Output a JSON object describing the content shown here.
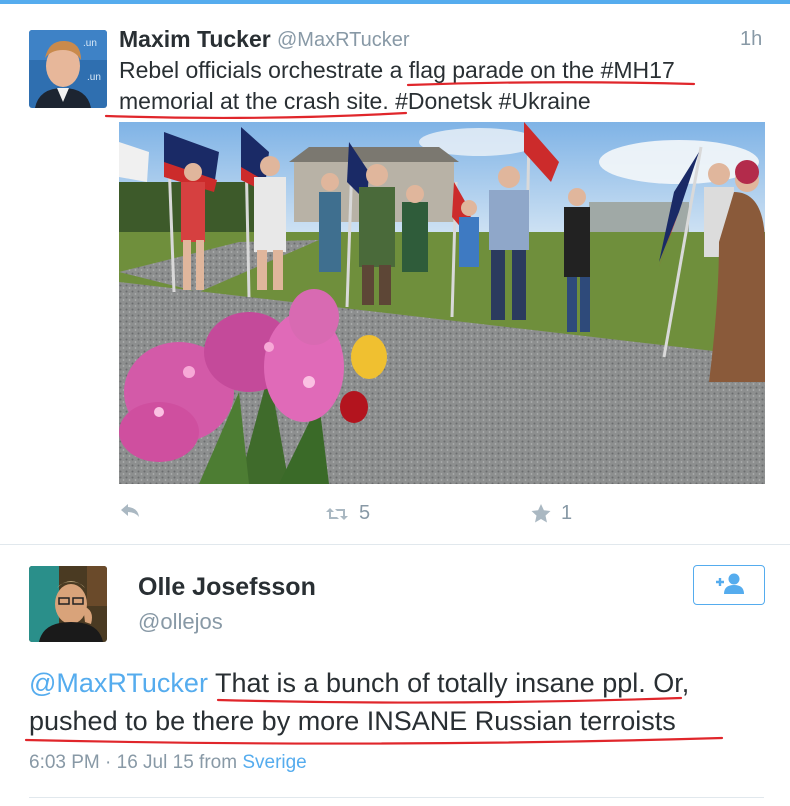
{
  "tweet": {
    "author_name": "Maxim Tucker",
    "author_handle": "@MaxRTucker",
    "time": "1h",
    "text_line1_a": "Rebel officials orchestrate a ",
    "text_line1_b": "flag parade on the #MH17",
    "text_line2_a": "memorial at the crash site.",
    "text_line2_b": " #Donetsk #Ukraine",
    "retweet_count": "5",
    "favorite_count": "1"
  },
  "reply": {
    "author_name": "Olle Josefsson",
    "author_handle": "@ollejos",
    "mention": "@MaxRTucker",
    "text_line1": " That is a bunch of totally insane ppl. Or,",
    "text_line2": "pushed to be there by more INSANE Russian terroists",
    "timestamp": "6:03 PM · 16 Jul 15 from ",
    "via": "Sverige"
  },
  "colors": {
    "accent": "#55acee",
    "text": "#292f33",
    "muted": "#8899a6",
    "annotation_red": "#e0262b"
  },
  "icons": {
    "reply": "reply-arrow-icon",
    "retweet": "retweet-icon",
    "favorite": "star-icon",
    "follow": "add-user-icon"
  }
}
